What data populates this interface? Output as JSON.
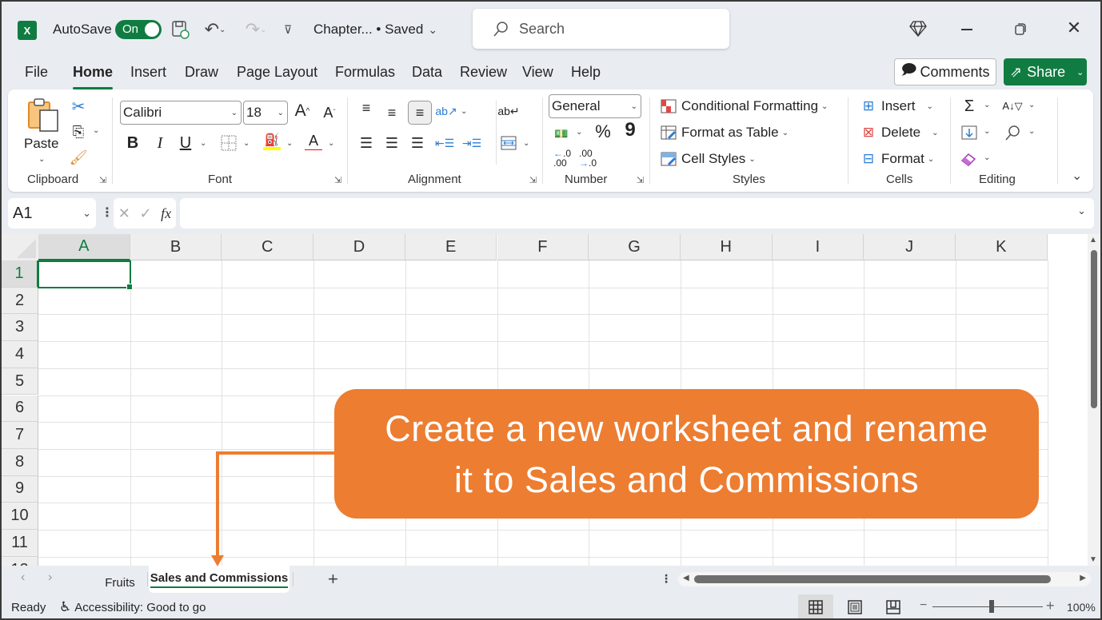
{
  "titlebar": {
    "app_icon": "excel-icon",
    "autosave_label": "AutoSave",
    "autosave_state": "On",
    "doc_title": "Chapter... • Saved",
    "search_placeholder": "Search",
    "window_controls": [
      "diamond-icon",
      "minimize-icon",
      "restore-icon",
      "close-icon"
    ]
  },
  "menu_tabs": [
    {
      "label": "File",
      "active": false
    },
    {
      "label": "Home",
      "active": true
    },
    {
      "label": "Insert",
      "active": false
    },
    {
      "label": "Draw",
      "active": false
    },
    {
      "label": "Page Layout",
      "active": false
    },
    {
      "label": "Formulas",
      "active": false
    },
    {
      "label": "Data",
      "active": false
    },
    {
      "label": "Review",
      "active": false
    },
    {
      "label": "View",
      "active": false
    },
    {
      "label": "Help",
      "active": false
    }
  ],
  "header_buttons": {
    "comments": "Comments",
    "share": "Share"
  },
  "ribbon": {
    "clipboard": {
      "label": "Clipboard",
      "paste": "Paste"
    },
    "font": {
      "label": "Font",
      "font_name": "Calibri",
      "font_size": "18",
      "bold": "B",
      "italic": "I",
      "underline": "U",
      "grow": "A",
      "shrink": "A",
      "font_color": "A",
      "fill_color_hex": "#ffff00",
      "font_color_hex": "#ff0000"
    },
    "alignment": {
      "label": "Alignment"
    },
    "number": {
      "label": "Number",
      "format": "General",
      "percent": "%",
      "comma": "9",
      "inc_decimal": "←.0 .00",
      "dec_decimal": ".00 →.0"
    },
    "styles": {
      "label": "Styles",
      "items": [
        "Conditional Formatting",
        "Format as Table",
        "Cell Styles"
      ]
    },
    "cells": {
      "label": "Cells",
      "items": [
        "Insert",
        "Delete",
        "Format"
      ]
    },
    "editing": {
      "label": "Editing",
      "sum": "Σ"
    }
  },
  "formula_bar": {
    "name_box": "A1",
    "fx": "fx",
    "value": ""
  },
  "grid": {
    "columns": [
      "A",
      "B",
      "C",
      "D",
      "E",
      "F",
      "G",
      "H",
      "I",
      "J",
      "K"
    ],
    "rows": [
      "1",
      "2",
      "3",
      "4",
      "5",
      "6",
      "7",
      "8",
      "9",
      "10",
      "11"
    ],
    "selected_cell": "A1"
  },
  "sheets": {
    "tabs": [
      {
        "label": "Fruits",
        "active": false
      },
      {
        "label": "Sales and Commissions",
        "active": true
      }
    ],
    "add_label": "+"
  },
  "status": {
    "ready": "Ready",
    "accessibility": "Accessibility: Good to go",
    "zoom": "100%",
    "zoom_level_fraction": 0.5
  },
  "callout": {
    "line1": "Create a new worksheet and rename",
    "line2": "it to Sales and Commissions",
    "color": "#ed7d31"
  }
}
